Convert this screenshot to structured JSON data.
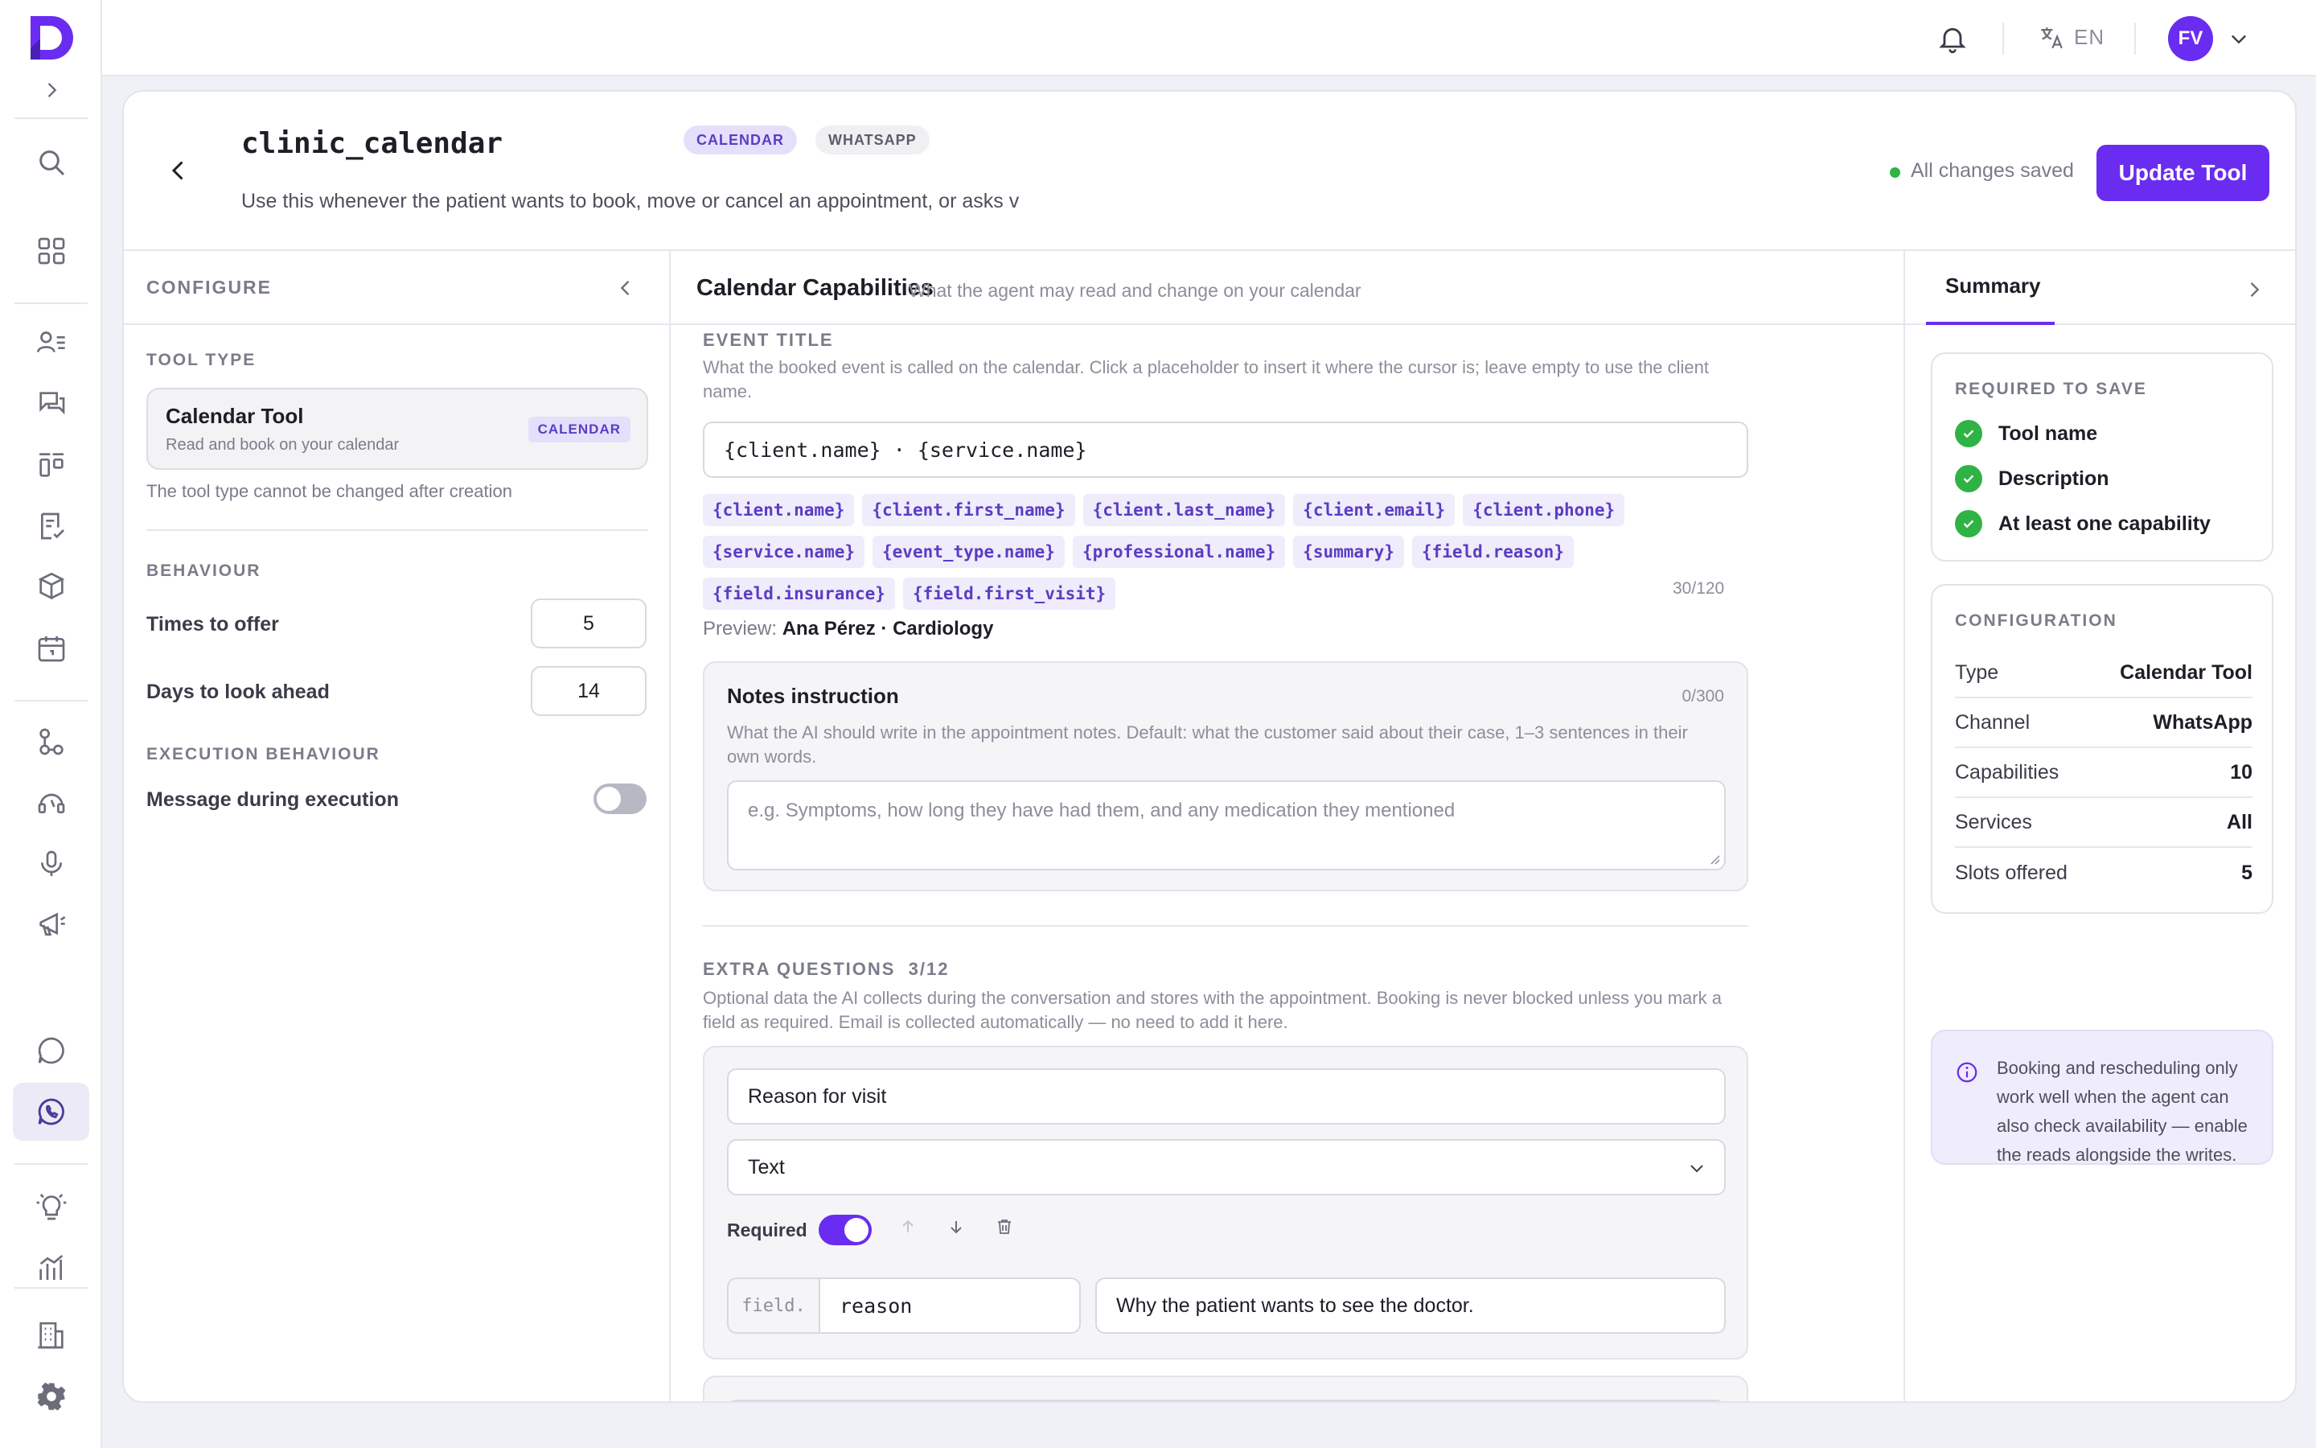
{
  "topbar": {
    "language": "EN",
    "avatar_initials": "FV"
  },
  "header": {
    "title": "clinic_calendar",
    "tags": [
      "CALENDAR",
      "WHATSAPP"
    ],
    "description": "Use this whenever the patient wants to book, move or cancel an appointment, or asks v",
    "save_status": "All changes saved",
    "update_button": "Update Tool"
  },
  "configure": {
    "heading": "CONFIGURE",
    "tool_type_label": "TOOL TYPE",
    "tool_type_name": "Calendar Tool",
    "tool_type_sub": "Read and book on your calendar",
    "tool_type_badge": "CALENDAR",
    "tool_type_note": "The tool type cannot be changed after creation",
    "behaviour_label": "BEHAVIOUR",
    "times_to_offer_label": "Times to offer",
    "times_to_offer": "5",
    "days_ahead_label": "Days to look ahead",
    "days_ahead": "14",
    "execution_label": "EXECUTION BEHAVIOUR",
    "message_during_execution_label": "Message during execution",
    "message_during_execution": false
  },
  "capabilities": {
    "title": "Calendar Capabilities",
    "subtitle": "What the agent may read and change on your calendar",
    "event_title_label": "EVENT TITLE",
    "event_title_help": "What the booked event is called on the calendar. Click a placeholder to insert it where the cursor is; leave empty to use the client name.",
    "event_title_value": "{client.name} · {service.name}",
    "placeholders": [
      "{client.name}",
      "{client.first_name}",
      "{client.last_name}",
      "{client.email}",
      "{client.phone}",
      "{service.name}",
      "{event_type.name}",
      "{professional.name}",
      "{summary}",
      "{field.reason}",
      "{field.insurance}",
      "{field.first_visit}"
    ],
    "event_title_counter": "30/120",
    "preview_label": "Preview:",
    "preview_value": "Ana Pérez · Cardiology",
    "notes_title": "Notes instruction",
    "notes_counter": "0/300",
    "notes_help": "What the AI should write in the appointment notes. Default: what the customer said about their case, 1–3 sentences in their own words.",
    "notes_placeholder": "e.g. Symptoms, how long they have had them, and any medication they mentioned",
    "extra_questions_label": "EXTRA QUESTIONS",
    "extra_questions_count": "3/12",
    "extra_questions_help": "Optional data the AI collects during the conversation and stores with the appointment. Booking is never blocked unless you mark a field as required. Email is collected automatically — no need to add it here.",
    "question": {
      "label": "Reason for visit",
      "type": "Text",
      "required_label": "Required",
      "required": true,
      "field_prefix": "field.",
      "field_key": "reason",
      "field_description": "Why the patient wants to see the doctor."
    }
  },
  "summary": {
    "tab": "Summary",
    "required_label": "REQUIRED TO SAVE",
    "required_items": [
      "Tool name",
      "Description",
      "At least one capability"
    ],
    "config_label": "CONFIGURATION",
    "config": [
      {
        "key": "Type",
        "value": "Calendar Tool"
      },
      {
        "key": "Channel",
        "value": "WhatsApp"
      },
      {
        "key": "Capabilities",
        "value": "10"
      },
      {
        "key": "Services",
        "value": "All"
      },
      {
        "key": "Slots offered",
        "value": "5"
      }
    ],
    "info": "Booking and rescheduling only work well when the agent can also check availability — enable the reads alongside the writes."
  },
  "colors": {
    "accent": "#6a2cf0",
    "success": "#2fb344",
    "chip_bg": "#efecfb",
    "chip_text": "#5b3cc4"
  }
}
